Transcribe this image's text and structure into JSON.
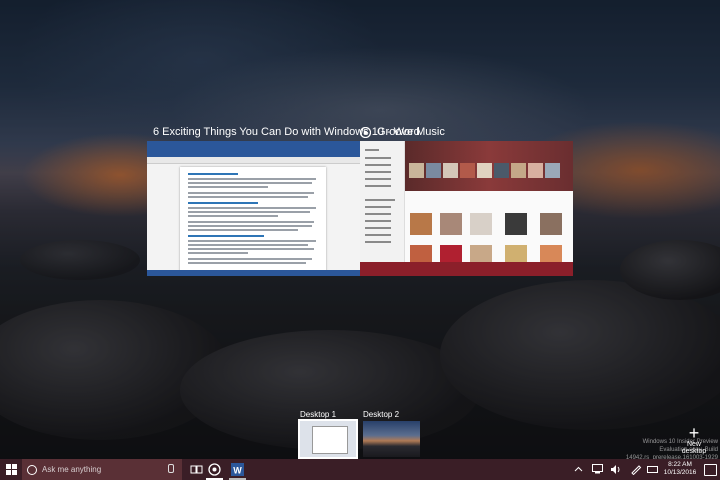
{
  "windows": [
    {
      "title": "6 Exciting Things You Can Do with Windows 10 - Word",
      "app_icon": "word-icon"
    },
    {
      "title": "Groove Music",
      "app_icon": "groove-music-icon"
    }
  ],
  "desktops": [
    {
      "label": "Desktop 1",
      "active": true
    },
    {
      "label": "Desktop 2",
      "active": false
    }
  ],
  "new_desktop_label": "New desktop",
  "taskbar": {
    "search_placeholder": "Ask me anything",
    "time": "8:22 AM",
    "date": "10/13/2016"
  },
  "watermark": {
    "line1": "Windows 10 Insider Preview",
    "line2": "Evaluation copy. Build 14942.rs_prerelease.161003-1929"
  },
  "colors": {
    "taskbar": "#3a1e26",
    "word_blue": "#2b579a",
    "groove_red": "#8b1f2a"
  }
}
